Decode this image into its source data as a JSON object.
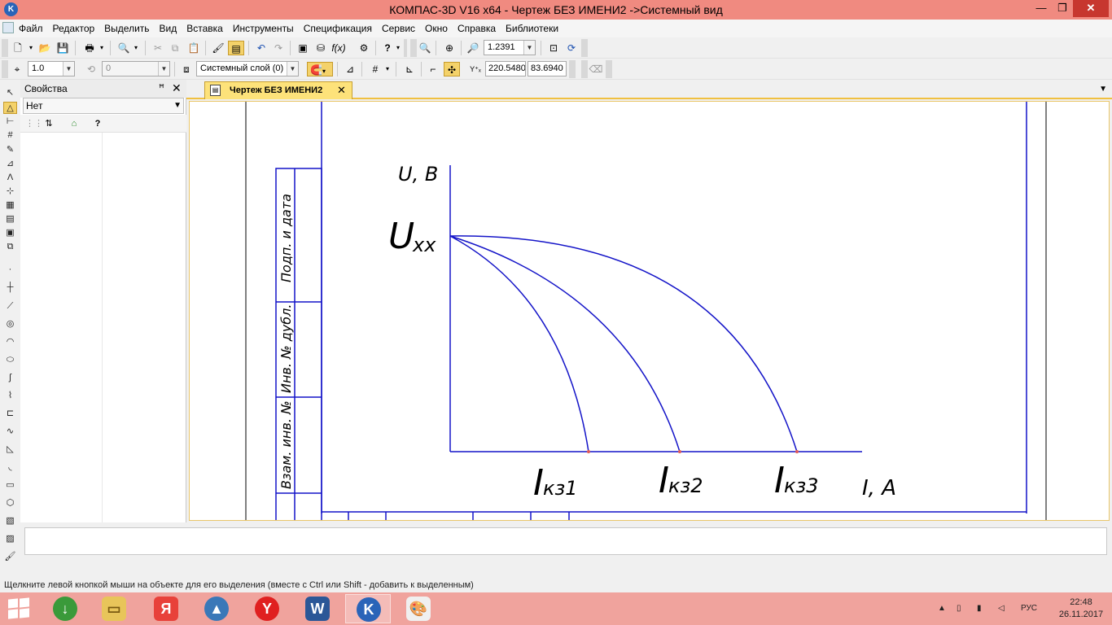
{
  "window": {
    "title": "КОМПАС-3D V16  x64 - Чертеж БЕЗ ИМЕНИ2 ->Системный вид",
    "app_icon_letter": "K",
    "min_glyph": "—",
    "max_glyph": "❐",
    "close_glyph": "✕"
  },
  "menu": [
    "Файл",
    "Редактор",
    "Выделить",
    "Вид",
    "Вставка",
    "Инструменты",
    "Спецификация",
    "Сервис",
    "Окно",
    "Справка",
    "Библиотеки"
  ],
  "toolbar1": {
    "zoom_value": "1.2391"
  },
  "toolbar2": {
    "style_value": "1.0",
    "step_value": "0",
    "layer_value": "Системный слой (0)",
    "coord_x": "220.5480",
    "coord_y": "83.6940"
  },
  "properties_panel": {
    "title": "Свойства",
    "pin_glyph": "ꟸ",
    "close_glyph": "✕",
    "selection": "Нет"
  },
  "document_tab": {
    "label": "Чертеж БЕЗ ИМЕНИ2",
    "close_glyph": "✕"
  },
  "drawing": {
    "stamp_labels": [
      "Подп. и дата",
      "Инв. № дубл.",
      "Взам. инв. №"
    ],
    "y_axis_label": "U, B",
    "x_axis_label": "I, A",
    "voltage_label_main": "U",
    "voltage_label_sub": "xx",
    "current_labels": [
      {
        "main": "I",
        "sub": "кз1"
      },
      {
        "main": "I",
        "sub": "кз2"
      },
      {
        "main": "I",
        "sub": "кз3"
      }
    ],
    "line_color": "#1414c8",
    "point_color": "#e05a5a"
  },
  "status_text": "Щелкните левой кнопкой мыши на объекте для его выделения (вместе с Ctrl или Shift - добавить к выделенным)",
  "taskbar": {
    "language": "РУС",
    "time": "22:48",
    "date": "26.11.2017"
  }
}
